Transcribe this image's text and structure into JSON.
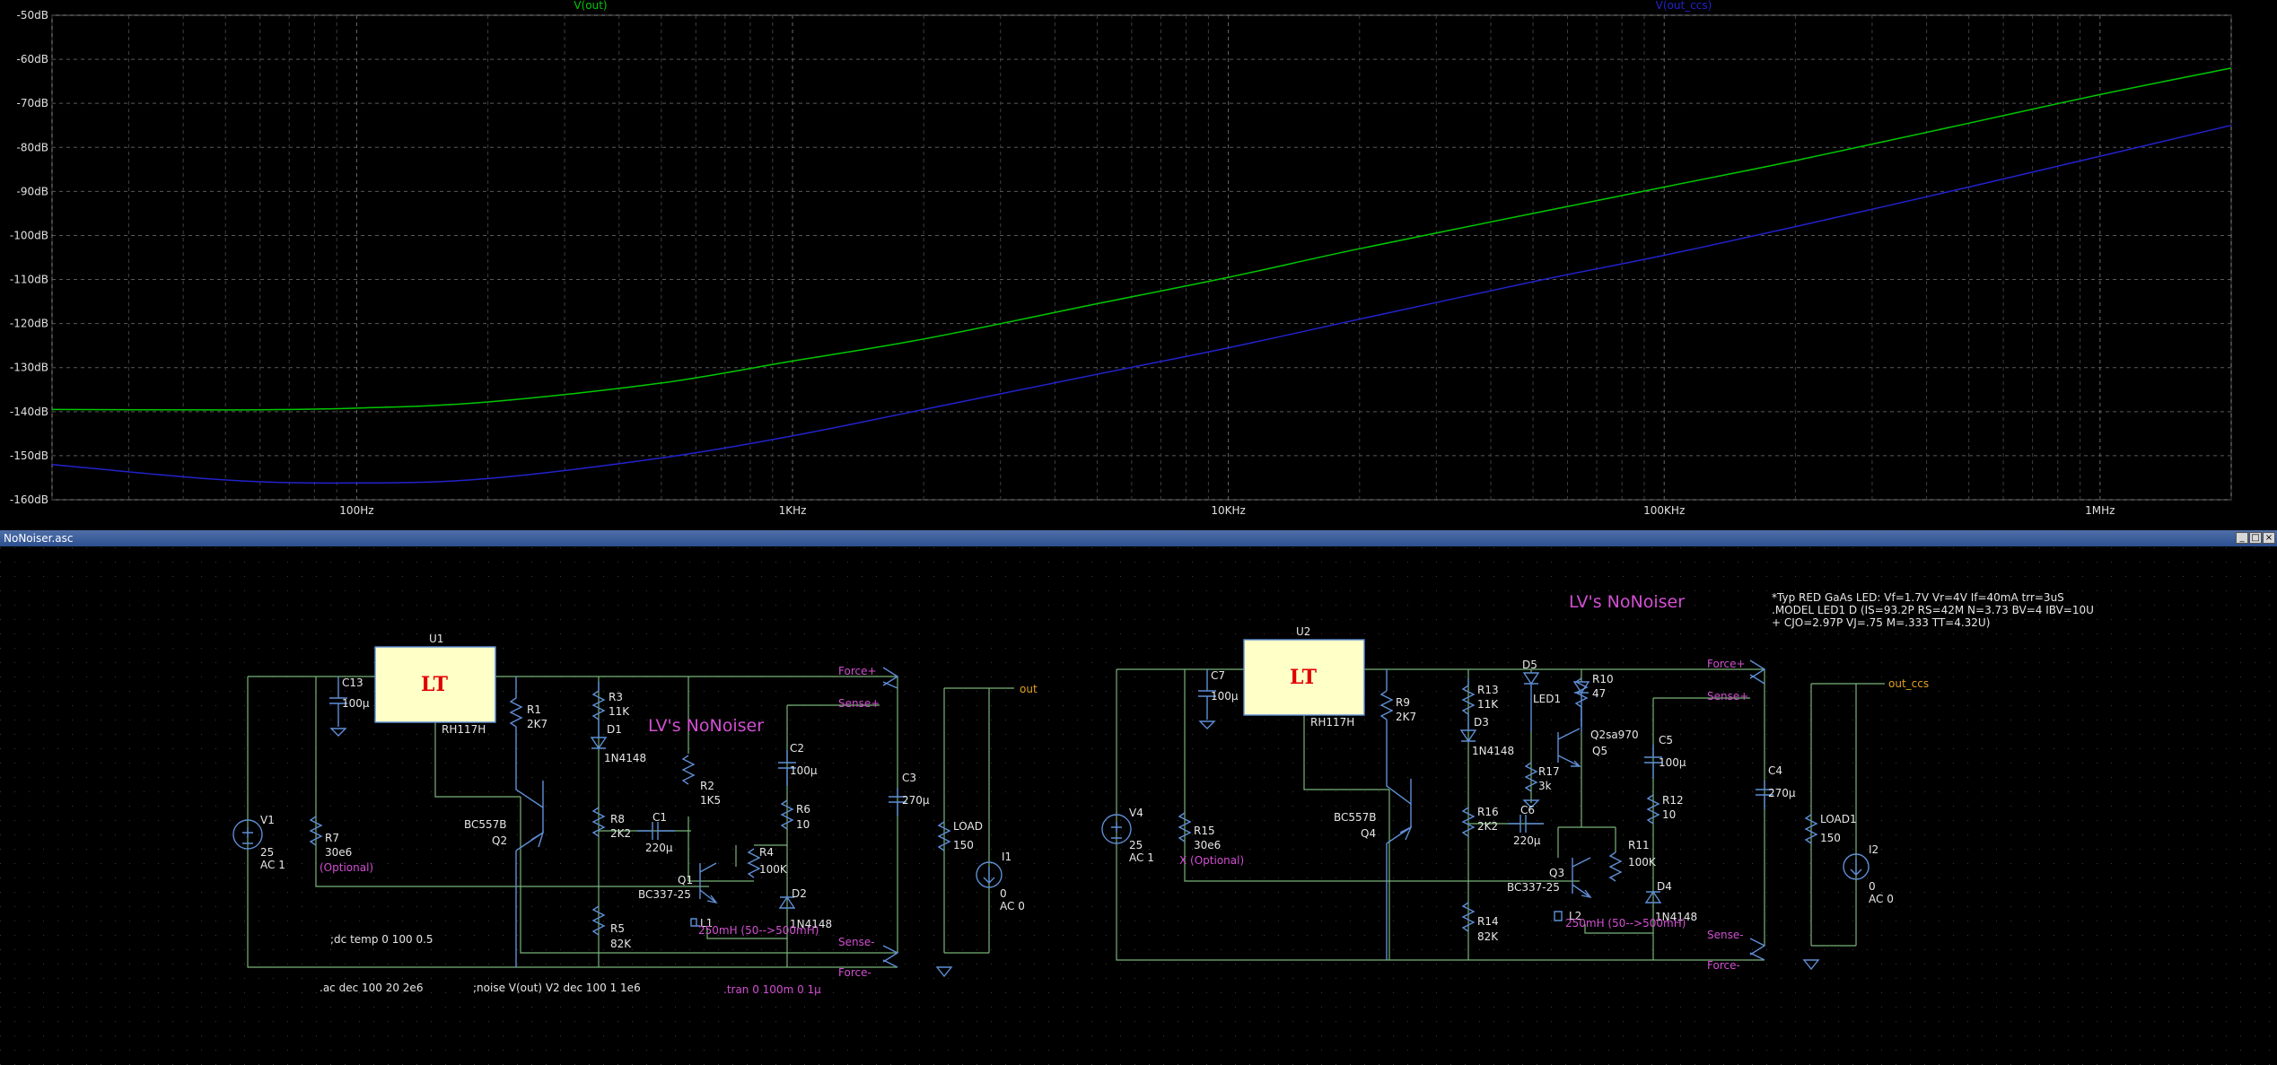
{
  "window_title": "NoNoiser.asc",
  "window_buttons": [
    "_",
    "□",
    "×"
  ],
  "plot": {
    "traces": [
      {
        "name": "V(out)",
        "color": "#00c800"
      },
      {
        "name": "V(out_ccs)",
        "color": "#2222cc"
      }
    ],
    "y_ticks": [
      "-50dB",
      "-60dB",
      "-70dB",
      "-80dB",
      "-90dB",
      "-100dB",
      "-110dB",
      "-120dB",
      "-130dB",
      "-140dB",
      "-150dB",
      "-160dB"
    ],
    "x_ticks": [
      "100Hz",
      "1KHz",
      "10KHz",
      "100KHz",
      "1MHz"
    ]
  },
  "chart_data": {
    "type": "line",
    "xlabel": "",
    "ylabel": "",
    "x_scale": "log",
    "xlim": [
      20,
      2000000
    ],
    "ylim": [
      -160,
      -50
    ],
    "grid": true,
    "series": [
      {
        "name": "V(out)",
        "color": "#00c800",
        "x": [
          20,
          50,
          100,
          200,
          500,
          1000,
          2000,
          5000,
          10000,
          20000,
          50000,
          100000,
          200000,
          500000,
          1000000,
          2000000
        ],
        "y": [
          -139.5,
          -139.6,
          -139.2,
          -137.8,
          -133.5,
          -128.5,
          -123.5,
          -115.5,
          -109.5,
          -103,
          -95,
          -89,
          -83,
          -74.5,
          -68,
          -62
        ]
      },
      {
        "name": "V(out_ccs)",
        "color": "#2222cc",
        "x": [
          20,
          50,
          100,
          200,
          500,
          1000,
          2000,
          5000,
          10000,
          20000,
          50000,
          100000,
          200000,
          500000,
          1000000,
          2000000
        ],
        "y": [
          -152,
          -155.5,
          -156.2,
          -155.2,
          -150.5,
          -145.5,
          -139.5,
          -131.5,
          -125.5,
          -119,
          -110.5,
          -104.5,
          -98,
          -89,
          -82,
          -75
        ]
      }
    ]
  },
  "schematic": {
    "title_left": "LV's NoNoiser",
    "title_right": "LV's NoNoiser",
    "model_note_1": "*Typ RED GaAs LED: Vf=1.7V Vr=4V If=40mA trr=3uS",
    "model_note_2": ".MODEL LED1 D (IS=93.2P RS=42M N=3.73 BV=4 IBV=10U",
    "model_note_3": "+ CJO=2.97P VJ=.75 M=.333 TT=4.32U)",
    "directive_dc": ";dc temp 0 100 0.5",
    "directive_ac": ".ac dec 100 20 2e6",
    "directive_noise": ";noise V(out) V2 dec 100 1 1e6",
    "directive_tran": ".tran 0 100m 0 1µ",
    "left": {
      "u_ref": "U1",
      "u_part": "RH117H",
      "c13": "C13",
      "c13_val": "100µ",
      "r1": "R1",
      "r1_val": "2K7",
      "r3": "R3",
      "r3_val": "11K",
      "d1": "D1",
      "d1_val": "1N4148",
      "r2": "R2",
      "r2_val": "1K5",
      "c2": "C2",
      "c2_val": "100µ",
      "r6": "R6",
      "r6_val": "10",
      "c3": "C3",
      "c3_val": "270µ",
      "load": "LOAD",
      "load_val": "150",
      "i1": "I1",
      "i1_val": "0",
      "i1_ac": "AC 0",
      "v1": "V1",
      "v1_val": "25",
      "v1_ac": "AC 1",
      "r7": "R7",
      "r7_val": "30e6",
      "r7_note": "(Optional)",
      "q2_part": "BC557B",
      "q2": "Q2",
      "r8": "R8",
      "r8_val": "2K2",
      "c1": "C1",
      "c1_val": "220µ",
      "q1": "Q1",
      "q1_part": "BC337-25",
      "r4": "R4",
      "r4_val": "100K",
      "d2": "D2",
      "d2_val": "1N4148",
      "r5": "R5",
      "r5_val": "82K",
      "l1": "L1",
      "l1_val": "250mH (50-->500mH)",
      "force_p": "Force+",
      "sense_p": "Sense+",
      "sense_n": "Sense-",
      "force_n": "Force-",
      "out": "out"
    },
    "right": {
      "u_ref": "U2",
      "u_part": "RH117H",
      "c7": "C7",
      "c7_val": "100µ",
      "r9": "R9",
      "r9_val": "2K7",
      "r13": "R13",
      "r13_val": "11K",
      "d3": "D3",
      "d3_val": "1N4148",
      "d5": "D5",
      "led": "LED1",
      "r10": "R10",
      "r10_val": "47",
      "q5_part": "Q2sa970",
      "q5": "Q5",
      "c5": "C5",
      "c5_val": "100µ",
      "r17": "R17",
      "r17_val": "3k",
      "r12": "R12",
      "r12_val": "10",
      "c4": "C4",
      "c4_val": "270µ",
      "load1": "LOAD1",
      "load1_val": "150",
      "i2": "I2",
      "i2_val": "0",
      "i2_ac": "AC 0",
      "v4": "V4",
      "v4_val": "25",
      "v4_ac": "AC 1",
      "r15": "R15",
      "r15_val": "30e6",
      "r15_note": "X (Optional)",
      "q4_part": "BC557B",
      "q4": "Q4",
      "r16": "R16",
      "r16_val": "2K2",
      "c6": "C6",
      "c6_val": "220µ",
      "q3": "Q3",
      "q3_part": "BC337-25",
      "r11": "R11",
      "r11_val": "100K",
      "d4": "D4",
      "d4_val": "1N4148",
      "r14": "R14",
      "r14_val": "82K",
      "l2": "L2",
      "l2_val": "250mH (50-->500mH)",
      "force_p": "Force+",
      "sense_p": "Sense+",
      "sense_n": "Sense-",
      "force_n": "Force-",
      "out": "out_ccs"
    }
  }
}
